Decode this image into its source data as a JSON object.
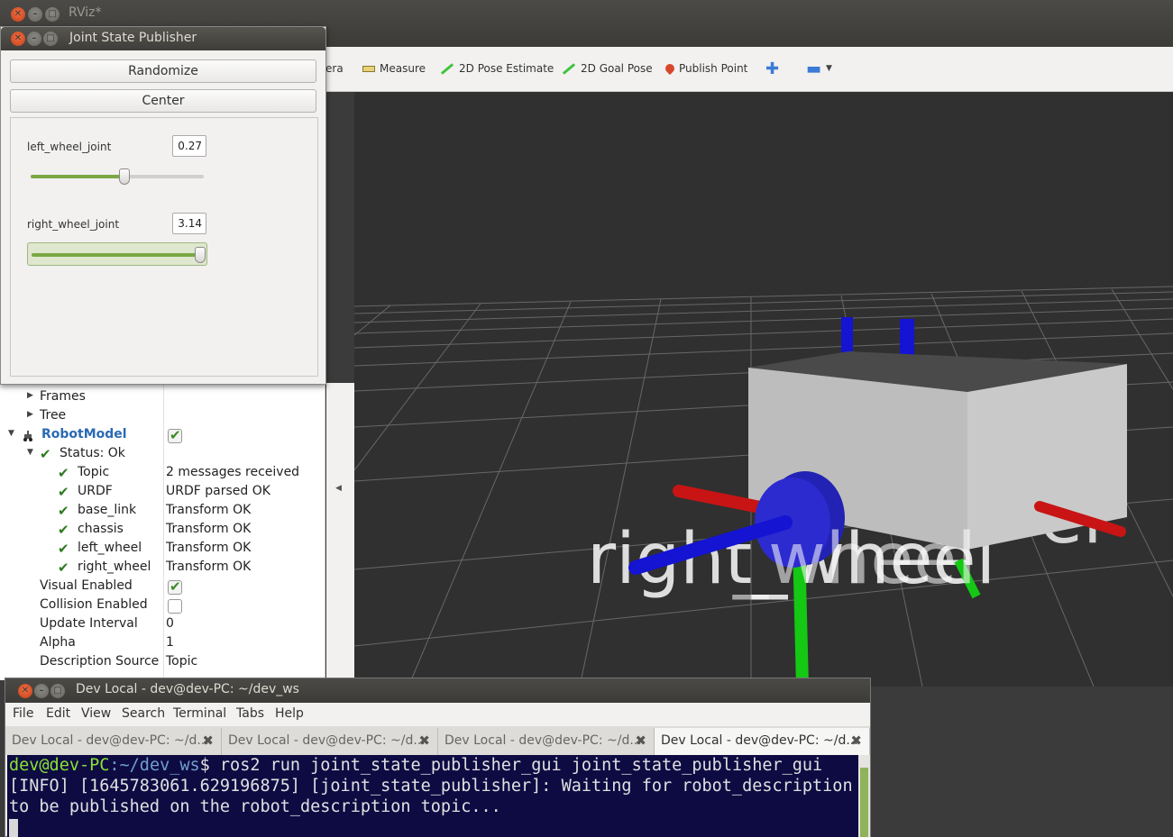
{
  "rviz": {
    "title": "RViz*",
    "toolbar": {
      "partial": "era",
      "measure": "Measure",
      "pose_estimate": "2D Pose Estimate",
      "goal_pose": "2D Goal Pose",
      "publish_point": "Publish Point",
      "plus_icon": "plus-icon",
      "minus_icon": "minus-icon"
    },
    "displays": {
      "frames": "Frames",
      "tree": "Tree",
      "robot_model": "RobotModel",
      "robot_model_enabled": true,
      "status": "Status: Ok",
      "status_items": [
        {
          "label": "Topic",
          "value": "2 messages received"
        },
        {
          "label": "URDF",
          "value": "URDF parsed OK"
        },
        {
          "label": "base_link",
          "value": "Transform OK"
        },
        {
          "label": "chassis",
          "value": "Transform OK"
        },
        {
          "label": "left_wheel",
          "value": "Transform OK"
        },
        {
          "label": "right_wheel",
          "value": "Transform OK"
        }
      ],
      "visual_enabled_label": "Visual Enabled",
      "visual_enabled": true,
      "collision_enabled_label": "Collision Enabled",
      "collision_enabled": false,
      "update_interval_label": "Update Interval",
      "update_interval": "0",
      "alpha_label": "Alpha",
      "alpha": "1",
      "description_source_label": "Description Source",
      "description_source": "Topic"
    },
    "scene": {
      "labels": [
        "right_wheel",
        "base_link",
        "left_wheel"
      ],
      "colors": {
        "chassis": "#bdbdbd",
        "wheel": "#2222c8",
        "x_axis": "#c81414",
        "y_axis": "#14c814",
        "z_axis": "#1414d2",
        "grid": "#8a8a8a"
      }
    }
  },
  "jsp": {
    "title": "Joint State Publisher",
    "randomize": "Randomize",
    "center": "Center",
    "joints": [
      {
        "name": "left_wheel_joint",
        "value": "0.27",
        "fraction": 0.54
      },
      {
        "name": "right_wheel_joint",
        "value": "3.14",
        "fraction": 1.0
      }
    ]
  },
  "terminal": {
    "title": "Dev Local - dev@dev-PC: ~/dev_ws",
    "menu": [
      "File",
      "Edit",
      "View",
      "Search",
      "Terminal",
      "Tabs",
      "Help"
    ],
    "tabs": [
      "Dev Local - dev@dev-PC: ~/d...",
      "Dev Local - dev@dev-PC: ~/d...",
      "Dev Local - dev@dev-PC: ~/d...",
      "Dev Local - dev@dev-PC: ~/d..."
    ],
    "prompt_user": "dev@dev-PC",
    "prompt_path": ":~/dev_ws",
    "command": "$ ros2 run joint_state_publisher_gui joint_state_publisher_gui",
    "output_1": "[INFO] [1645783061.629196875] [joint_state_publisher]: Waiting for robot_description",
    "output_2": "to be published on the robot_description topic..."
  }
}
